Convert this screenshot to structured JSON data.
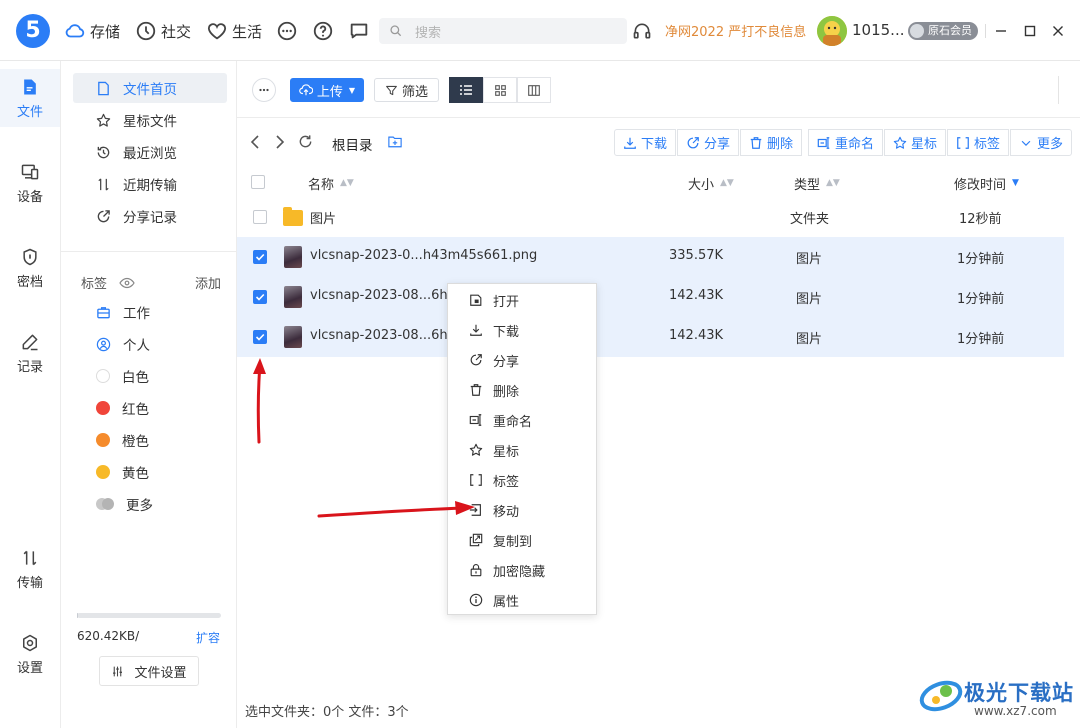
{
  "app": {
    "logo_text": "5"
  },
  "topnav": {
    "items": [
      {
        "label": "存储",
        "icon": "cloud-icon"
      },
      {
        "label": "社交",
        "icon": "clock-icon"
      },
      {
        "label": "生活",
        "icon": "heart-icon"
      }
    ],
    "search_placeholder": "搜索",
    "notice": "净网2022 严打不良信息",
    "username": "1015...",
    "vip_label": "原石会员"
  },
  "rail": {
    "items": [
      {
        "label": "文件",
        "icon": "file-icon",
        "active": true
      },
      {
        "label": "设备",
        "icon": "devices-icon"
      },
      {
        "label": "密档",
        "icon": "shield-icon"
      },
      {
        "label": "记录",
        "icon": "pen-icon"
      },
      {
        "label": "传输",
        "icon": "transfer-icon"
      },
      {
        "label": "设置",
        "icon": "settings-icon"
      }
    ]
  },
  "sidebar": {
    "nav": [
      {
        "label": "文件首页",
        "icon": "file-home-icon",
        "active": true
      },
      {
        "label": "星标文件",
        "icon": "star-icon"
      },
      {
        "label": "最近浏览",
        "icon": "history-icon"
      },
      {
        "label": "近期传输",
        "icon": "transfer-icon"
      },
      {
        "label": "分享记录",
        "icon": "share-icon"
      }
    ],
    "tags_title": "标签",
    "tags_add": "添加",
    "tags": [
      {
        "label": "工作",
        "icon": "briefcase-icon",
        "color": "#2b7df6"
      },
      {
        "label": "个人",
        "icon": "person-icon",
        "color": "#2b7df6"
      },
      {
        "label": "白色",
        "color": "#ffffff"
      },
      {
        "label": "红色",
        "color": "#f0453a"
      },
      {
        "label": "橙色",
        "color": "#f58b2c"
      },
      {
        "label": "黄色",
        "color": "#f7b928"
      },
      {
        "label": "更多",
        "color": "#c8c8c8"
      }
    ],
    "quota_text": "620.42KB/",
    "quota_fraction": 0.01,
    "expand_label": "扩容",
    "file_settings_label": "文件设置"
  },
  "toolbar": {
    "upload_label": "上传",
    "filter_label": "筛选"
  },
  "path": {
    "current": "根目录"
  },
  "actions": [
    {
      "label": "下载",
      "icon": "download-icon"
    },
    {
      "label": "分享",
      "icon": "share-icon"
    },
    {
      "label": "删除",
      "icon": "trash-icon"
    },
    {
      "label": "重命名",
      "icon": "rename-icon"
    },
    {
      "label": "星标",
      "icon": "star-icon"
    },
    {
      "label": "标签",
      "icon": "tag-icon"
    },
    {
      "label": "更多",
      "icon": "chevron-down-icon"
    }
  ],
  "table": {
    "columns": {
      "name": "名称",
      "size": "大小",
      "type": "类型",
      "modified": "修改时间"
    },
    "rows": [
      {
        "name": "图片",
        "size": "",
        "type": "文件夹",
        "modified": "12秒前",
        "kind": "folder",
        "selected": false
      },
      {
        "name": "vlcsnap-2023-0...h43m45s661.png",
        "size": "335.57K",
        "type": "图片",
        "modified": "1分钟前",
        "kind": "image",
        "selected": true
      },
      {
        "name": "vlcsnap-2023-08...6h4",
        "size": "142.43K",
        "type": "图片",
        "modified": "1分钟前",
        "kind": "image",
        "selected": true
      },
      {
        "name": "vlcsnap-2023-08...6h4",
        "size": "142.43K",
        "type": "图片",
        "modified": "1分钟前",
        "kind": "image",
        "selected": true
      }
    ]
  },
  "status": {
    "text": "选中文件夹：0个 文件：3个"
  },
  "context_menu": {
    "items": [
      {
        "label": "打开",
        "icon": "open-icon"
      },
      {
        "label": "下载",
        "icon": "download-icon"
      },
      {
        "label": "分享",
        "icon": "share-icon"
      },
      {
        "label": "删除",
        "icon": "trash-icon"
      },
      {
        "label": "重命名",
        "icon": "rename-icon"
      },
      {
        "label": "星标",
        "icon": "star-icon"
      },
      {
        "label": "标签",
        "icon": "tag-icon"
      },
      {
        "label": "移动",
        "icon": "move-icon"
      },
      {
        "label": "复制到",
        "icon": "copy-icon"
      },
      {
        "label": "加密隐藏",
        "icon": "lock-icon"
      },
      {
        "label": "属性",
        "icon": "info-icon"
      }
    ]
  },
  "watermark": {
    "title": "极光下载站",
    "url": "www.xz7.com"
  },
  "colors": {
    "accent": "#2b7df6",
    "notice": "#e08a3a",
    "annotation_arrow": "#d9141b"
  }
}
